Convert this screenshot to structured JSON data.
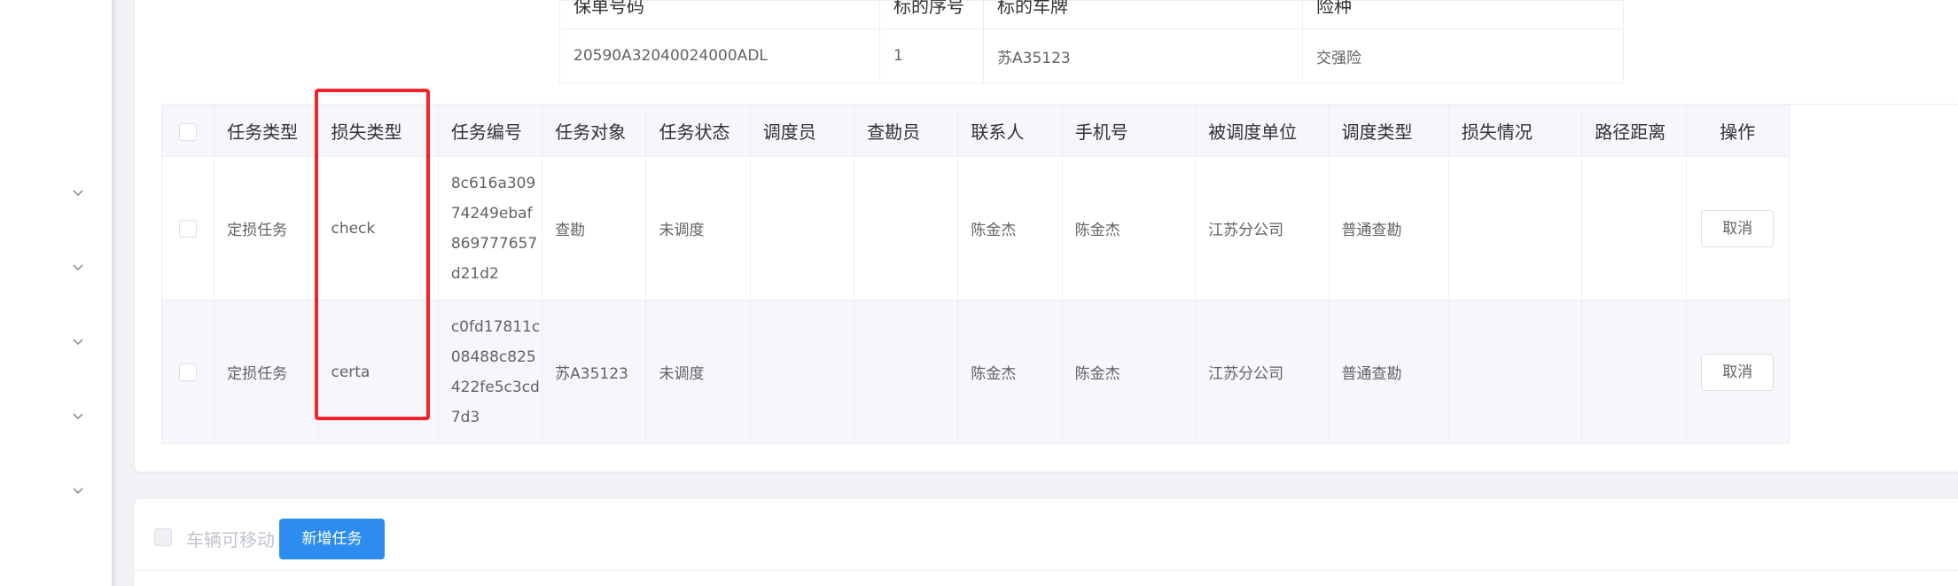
{
  "sidebar": {
    "menu_items": [
      {
        "icon": "chevron-down-icon"
      },
      {
        "icon": "chevron-down-icon"
      },
      {
        "icon": "chevron-down-icon"
      },
      {
        "icon": "chevron-down-icon"
      },
      {
        "icon": "chevron-down-icon"
      }
    ]
  },
  "policy_table": {
    "headers": [
      "保单号码",
      "标的序号",
      "标的车牌",
      "险种"
    ],
    "row": [
      "20590A32040024000ADL",
      "1",
      "苏A35123",
      "交强险"
    ]
  },
  "task_table": {
    "headers": [
      "任务类型",
      "损失类型",
      "任务编号",
      "任务对象",
      "任务状态",
      "调度员",
      "查勘员",
      "联系人",
      "手机号",
      "被调度单位",
      "调度类型",
      "损失情况",
      "路径距离",
      "操作"
    ],
    "rows": [
      {
        "task_type": "定损任务",
        "loss_type": "check",
        "task_no": "8c616a30974249ebaf869777657d21d2",
        "task_object": "查勘",
        "task_status": "未调度",
        "dispatcher": "",
        "surveyor": "",
        "contact": "陈金杰",
        "phone": "陈金杰",
        "unit": "江苏分公司",
        "dispatch_type": "普通查勘",
        "loss_info": "",
        "distance": "",
        "action": "取消"
      },
      {
        "task_type": "定损任务",
        "loss_type": "certa",
        "task_no": "c0fd17811c08488c825422fe5c3cd7d3",
        "task_object": "苏A35123",
        "task_status": "未调度",
        "dispatcher": "",
        "surveyor": "",
        "contact": "陈金杰",
        "phone": "陈金杰",
        "unit": "江苏分公司",
        "dispatch_type": "普通查勘",
        "loss_info": "",
        "distance": "",
        "action": "取消"
      }
    ]
  },
  "highlight": {
    "color": "#f5222d"
  },
  "bottom_bar": {
    "vehicle_movable_label": "车辆可移动",
    "add_task_button": "新增任务"
  },
  "colors": {
    "primary": "#2d8cf0",
    "background": "#f0f2f5",
    "header_bg": "#f5f7fa"
  }
}
